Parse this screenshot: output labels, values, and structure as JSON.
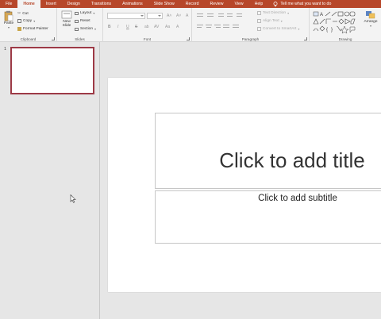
{
  "ribbon_tabs": [
    "File",
    "Home",
    "Insert",
    "Design",
    "Transitions",
    "Animations",
    "Slide Show",
    "Record",
    "Review",
    "View",
    "Help"
  ],
  "active_tab": "Home",
  "tell_me": "Tell me what you want to do",
  "clipboard": {
    "paste": "Paste",
    "cut": "Cut",
    "copy": "Copy",
    "format_painter": "Format Painter",
    "label": "Clipboard"
  },
  "slides_group": {
    "new_slide_line1": "New",
    "new_slide_line2": "Slide",
    "layout": "Layout",
    "reset": "Reset",
    "section": "Section",
    "label": "Slides"
  },
  "font_group": {
    "bold": "B",
    "italic": "I",
    "underline": "U",
    "strike": "S",
    "label": "Font"
  },
  "paragraph_group": {
    "text_direction": "Text Direction",
    "align_text": "Align Text",
    "convert_smartart": "Convert to SmartArt",
    "label": "Paragraph"
  },
  "drawing_group": {
    "arrange": "Arrange",
    "label": "Drawing"
  },
  "thumbnail": {
    "number": "1"
  },
  "slide": {
    "title_placeholder": "Click to add title",
    "subtitle_placeholder": "Click to add subtitle"
  },
  "colors": {
    "accent": "#b7472a",
    "thumb_border": "#9d3a46"
  }
}
